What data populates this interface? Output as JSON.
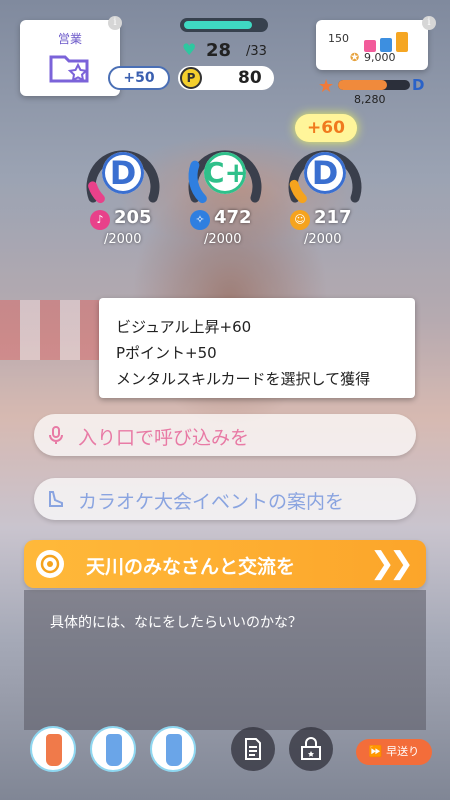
{
  "job": {
    "label": "営業",
    "icon": "folder-star-icon"
  },
  "stamina": {
    "current": "28",
    "max": "/33",
    "fraction": 0.85
  },
  "points": {
    "bonus": "+50",
    "coin": "P",
    "value": "80"
  },
  "rank": {
    "fans_level": "150",
    "star_value": "9,000",
    "fan_count": "8,280",
    "grade": "D",
    "fan_progress": 0.68,
    "bar_colors": [
      "#f25b9a",
      "#3d8fe0",
      "#f5a623"
    ]
  },
  "stats": [
    {
      "rank": "D",
      "value": "205",
      "max": "/2000",
      "color": "#e8418a",
      "rank_color": "#3a6fd0",
      "fill": 0.1
    },
    {
      "rank": "C+",
      "value": "472",
      "max": "/2000",
      "color": "#2f7fe0",
      "rank_color": "#2fc08a",
      "fill": 0.24
    },
    {
      "rank": "D",
      "value": "217",
      "max": "/2000",
      "color": "#f5a31e",
      "rank_color": "#3a6fd0",
      "fill": 0.11,
      "bonus": "+60"
    }
  ],
  "effects": [
    "ビジュアル上昇+60",
    "Pポイント+50",
    "メンタルスキルカードを選択して獲得"
  ],
  "choices": [
    {
      "text": "入り口で呼び込みを",
      "color": "#e87aa5"
    },
    {
      "text": "カラオケ大会イベントの案内を",
      "color": "#8aa4e0"
    },
    {
      "text": "天川のみなさんと交流を",
      "selected": true
    }
  ],
  "description": "具体的には、なにをしたらいいのかな？",
  "fast_forward": "早送り",
  "items": [
    {
      "color": "#f07a4a"
    },
    {
      "color": "#6aa5e8"
    },
    {
      "color": "#6aa5e8"
    }
  ]
}
